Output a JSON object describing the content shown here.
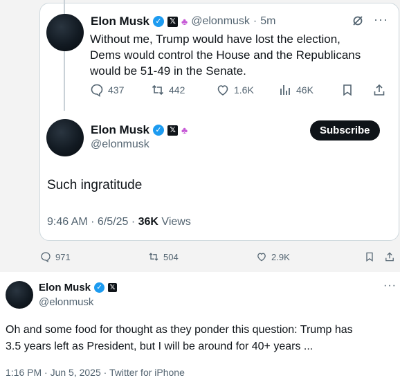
{
  "quoted_reply": {
    "author_name": "Elon Musk",
    "handle": "@elonmusk",
    "time": "5m",
    "text_lines": [
      "Without me, Trump would have lost the election,",
      "Dems would control the House and the Republicans",
      "would be 51-49 in the Senate."
    ],
    "stats": {
      "replies": "437",
      "reposts": "442",
      "likes": "1.6K",
      "views": "46K"
    }
  },
  "quoted_main": {
    "author_name": "Elon Musk",
    "handle": "@elonmusk",
    "subscribe_label": "Subscribe",
    "text": "Such ingratitude",
    "meta_time": "9:46 AM · 6/5/25 · ",
    "meta_views_count": "36K",
    "meta_views_label": " Views"
  },
  "outer_stats": {
    "replies": "971",
    "reposts": "504",
    "likes": "2.9K"
  },
  "main_tweet": {
    "author_name": "Elon Musk",
    "handle": "@elonmusk",
    "text_line1": "Oh and some food for thought as they ponder this question: Trump has",
    "text_line2": "3.5 years left as President, but I will be around for 40+ years ...",
    "footer": "1:16 PM · Jun 5, 2025 · Twitter for iPhone"
  },
  "colors": {
    "accent": "#1d9bf0",
    "text": "#0f1419",
    "muted": "#536471",
    "badge_pink": "#c65ad6"
  }
}
